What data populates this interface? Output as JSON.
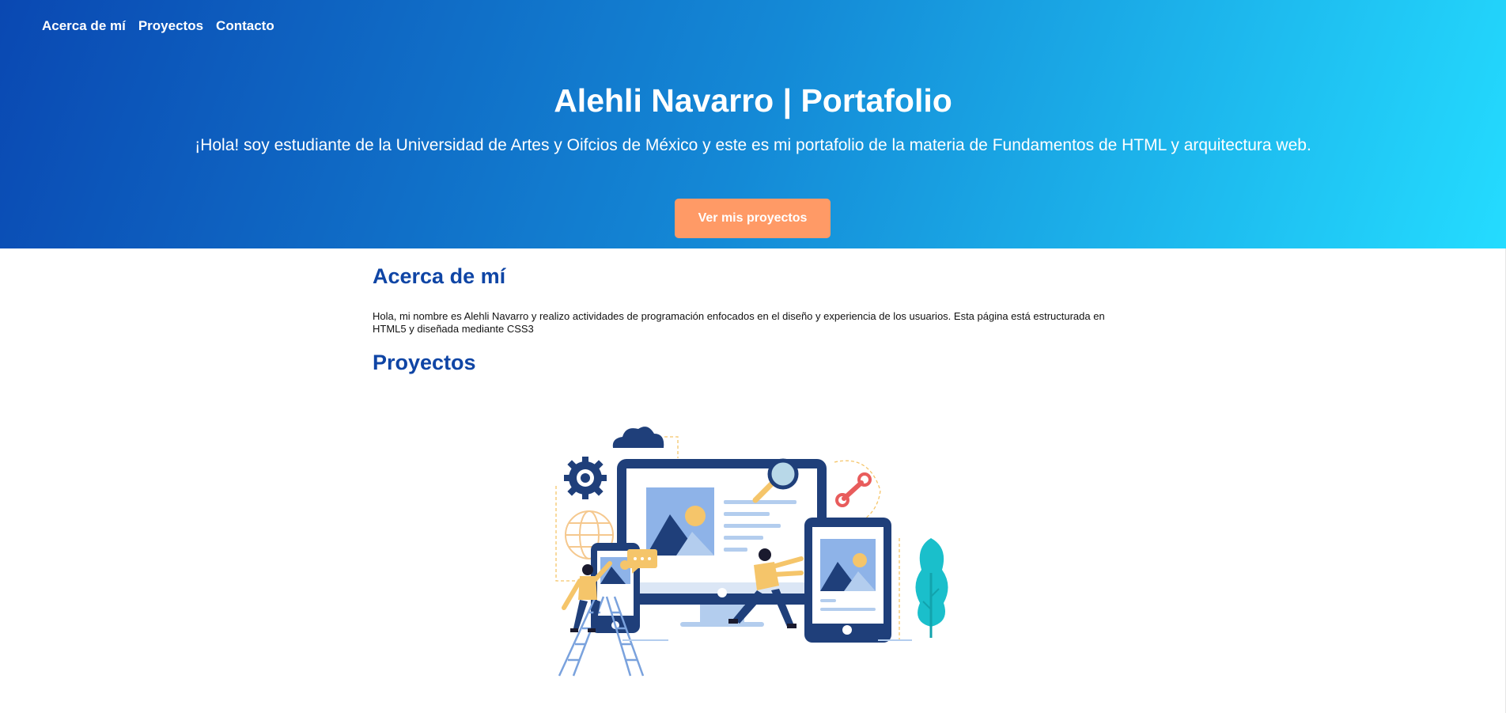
{
  "nav": {
    "items": [
      {
        "label": "Acerca de mí"
      },
      {
        "label": "Proyectos"
      },
      {
        "label": "Contacto"
      }
    ]
  },
  "hero": {
    "title": "Alehli Navarro | Portafolio",
    "subtitle": "¡Hola! soy estudiante de la Universidad de Artes y Oifcios de México y este es mi portafolio de la materia de Fundamentos de HTML y arquitectura web.",
    "cta_label": "Ver mis proyectos"
  },
  "about": {
    "heading": "Acerca de mí",
    "text": "Hola, mi nombre es Alehli Navarro y realizo actividades de programación enfocados en el diseño y experiencia de los usuarios. Esta página está estructurada en HTML5 y diseñada mediante CSS3"
  },
  "projects": {
    "heading": "Proyectos",
    "illustration": "web-design-illustration"
  },
  "colors": {
    "hero_gradient_start": "#0a48b2",
    "hero_gradient_end": "#24dcff",
    "cta": "#ff9a66",
    "heading": "#0f45a5"
  }
}
